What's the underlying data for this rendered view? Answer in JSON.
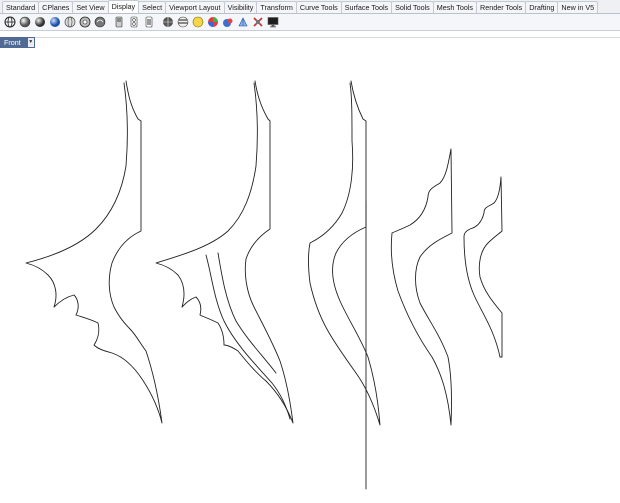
{
  "toolbar_tabs": [
    {
      "label": "Standard",
      "active": false
    },
    {
      "label": "CPlanes",
      "active": false
    },
    {
      "label": "Set View",
      "active": false
    },
    {
      "label": "Display",
      "active": true
    },
    {
      "label": "Select",
      "active": false
    },
    {
      "label": "Viewport Layout",
      "active": false
    },
    {
      "label": "Visibility",
      "active": false
    },
    {
      "label": "Transform",
      "active": false
    },
    {
      "label": "Curve Tools",
      "active": false
    },
    {
      "label": "Surface Tools",
      "active": false
    },
    {
      "label": "Solid Tools",
      "active": false
    },
    {
      "label": "Mesh Tools",
      "active": false
    },
    {
      "label": "Render Tools",
      "active": false
    },
    {
      "label": "Drafting",
      "active": false
    },
    {
      "label": "New in V5",
      "active": false
    }
  ],
  "display_icons": [
    "wireframe-viewport-icon",
    "shaded-viewport-icon",
    "rendered-viewport-icon",
    "ghosted-viewport-icon",
    "xray-viewport-icon",
    "technical-viewport-icon",
    "artistic-viewport-icon",
    "pen-viewport-icon",
    "flip-shade-icon",
    "shade-selected-icon",
    "render-mesh-icon",
    "zebra-analysis-icon",
    "environment-map-icon",
    "curvature-analysis-icon",
    "draft-angle-analysis-icon",
    "edge-analysis-icon",
    "light-icon",
    "display-settings-icon"
  ],
  "viewport": {
    "name": "Front",
    "dropdown_symbol": "▼"
  },
  "colors": {
    "viewport_label_bg": "#4f6b93",
    "curve_stroke": "#222222",
    "background": "#ffffff"
  }
}
